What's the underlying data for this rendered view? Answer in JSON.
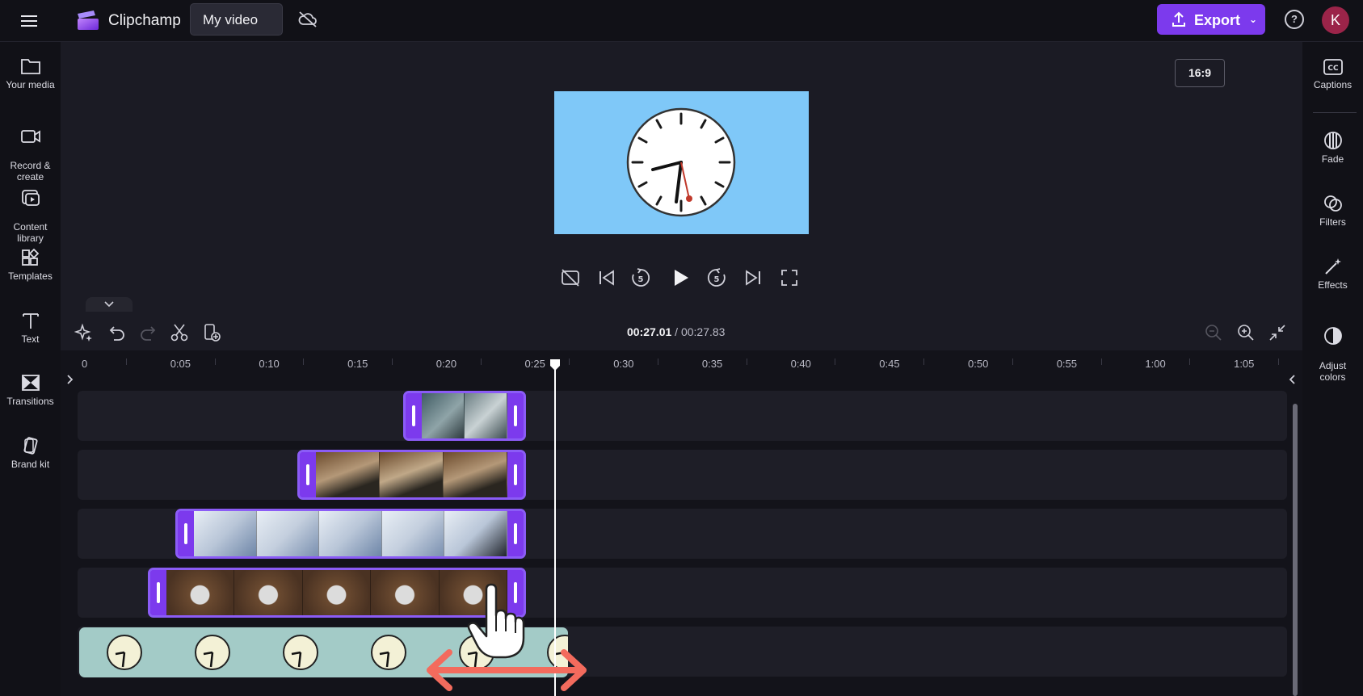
{
  "app": {
    "brand": "Clipchamp",
    "video_title": "My video",
    "export_label": "Export",
    "avatar_initial": "K",
    "help_label": "?"
  },
  "left_rail": [
    {
      "label": "Your media",
      "icon": "folder-icon"
    },
    {
      "label": "Record &\ncreate",
      "icon": "video-camera-icon"
    },
    {
      "label": "Content\nlibrary",
      "icon": "library-icon"
    },
    {
      "label": "Templates",
      "icon": "templates-icon"
    },
    {
      "label": "Text",
      "icon": "text-icon"
    },
    {
      "label": "Transitions",
      "icon": "transitions-icon"
    },
    {
      "label": "Brand kit",
      "icon": "brand-kit-icon"
    }
  ],
  "right_rail": [
    {
      "label": "Captions",
      "icon": "captions-icon"
    },
    {
      "label": "Fade",
      "icon": "fade-icon"
    },
    {
      "label": "Filters",
      "icon": "filters-icon"
    },
    {
      "label": "Effects",
      "icon": "effects-icon"
    },
    {
      "label": "Adjust\ncolors",
      "icon": "adjust-colors-icon"
    }
  ],
  "preview": {
    "aspect_ratio": "16:9",
    "background_color": "#7fc8f8"
  },
  "timeline": {
    "current_time": "00:27.01",
    "separator": " / ",
    "total_time": "00:27.83",
    "ruler": [
      "0",
      "0:05",
      "0:10",
      "0:15",
      "0:20",
      "0:25",
      "0:30",
      "0:35",
      "0:40",
      "0:45",
      "0:50",
      "0:55",
      "1:00",
      "1:05"
    ],
    "accent_color": "#7c3aed",
    "clip_border_color": "#8b5cf6"
  }
}
